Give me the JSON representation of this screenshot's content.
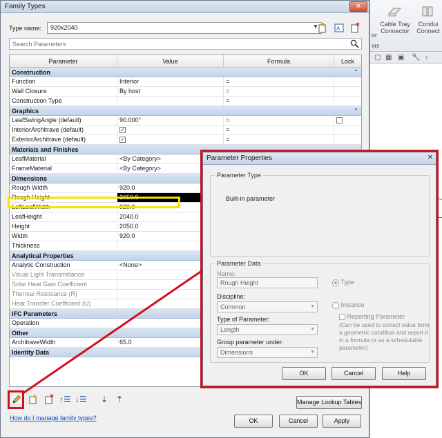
{
  "background_app": {
    "ribbon": [
      {
        "label_line1": "Cable Tray",
        "label_line2": "Connector",
        "icon": "cable-tray-connector-icon"
      },
      {
        "label_line1": "Condui",
        "label_line2": "Connect",
        "icon": "conduit-connector-icon"
      }
    ],
    "partial_label_1": "or",
    "tab_row": "ors"
  },
  "family_types": {
    "title": "Family Types",
    "close_label": "✕",
    "type_name_label": "Type name:",
    "type_name_value": "920x2040",
    "search_placeholder": "Search Parameters",
    "columns": [
      "Parameter",
      "Value",
      "Formula",
      "Lock"
    ],
    "groups": [
      {
        "name": "Construction",
        "rows": [
          {
            "param": "Function",
            "value": "Interior",
            "formula": "="
          },
          {
            "param": "Wall Closure",
            "value": "By host",
            "formula": "="
          },
          {
            "param": "Construction Type",
            "value": "",
            "formula": "="
          }
        ]
      },
      {
        "name": "Graphics",
        "rows": [
          {
            "param": "LeafSwingAngle (default)",
            "value": "90.000°",
            "formula": "=",
            "lock": true
          },
          {
            "param": "InteriorArchitrave (default)",
            "value": "checked",
            "formula": "="
          },
          {
            "param": "ExteriorArchitrave (default)",
            "value": "checked",
            "formula": "="
          }
        ]
      },
      {
        "name": "Materials and Finishes",
        "rows": [
          {
            "param": "LeafMaterial",
            "value": "<By Category>",
            "formula": ""
          },
          {
            "param": "FrameMaterial",
            "value": "<By Category>",
            "formula": ""
          }
        ]
      },
      {
        "name": "Dimensions",
        "rows": [
          {
            "param": "Rough Width",
            "value": "920.0",
            "formula": ""
          },
          {
            "param": "Rough Height",
            "value": "2050.0",
            "formula": ""
          },
          {
            "param": "LeftLeafWidth",
            "value": "920.0",
            "formula": ""
          },
          {
            "param": "LeafHeight",
            "value": "2040.0",
            "formula": ""
          },
          {
            "param": "Height",
            "value": "2050.0",
            "formula": ""
          },
          {
            "param": "Width",
            "value": "920.0",
            "formula": ""
          },
          {
            "param": "Thickness",
            "value": "",
            "formula": ""
          }
        ]
      },
      {
        "name": "Analytical Properties",
        "rows": [
          {
            "param": "Analytic Construction",
            "value": "<None>",
            "formula": ""
          },
          {
            "param": "Visual Light Transmittance",
            "value": "",
            "formula": ""
          },
          {
            "param": "Solar Heat Gain Coefficient",
            "value": "",
            "formula": ""
          },
          {
            "param": "Thermal Resistance (R)",
            "value": "",
            "formula": ""
          },
          {
            "param": "Heat Transfer Coefficient (U)",
            "value": "",
            "formula": ""
          }
        ]
      },
      {
        "name": "IFC Parameters",
        "rows": [
          {
            "param": "Operation",
            "value": "",
            "formula": ""
          }
        ]
      },
      {
        "name": "Other",
        "rows": [
          {
            "param": "ArchitraveWidth",
            "value": "65.0",
            "formula": ""
          }
        ]
      },
      {
        "name": "Identity Data",
        "rows": []
      }
    ],
    "collapse_glyph": "⌃",
    "buttons": {
      "manage_lookup": "Manage Lookup Tables",
      "ok": "OK",
      "cancel": "Cancel",
      "apply": "Apply"
    },
    "help_link": "How do I manage family types?"
  },
  "parameter_properties": {
    "title": "Parameter Properties",
    "close_label": "✕",
    "parameter_type_legend": "Parameter Type",
    "builtin_label": "Built-in parameter",
    "parameter_data_legend": "Parameter Data",
    "name_label": "Name:",
    "name_value": "Rough Height",
    "type_radio": "Type",
    "discipline_label": "Discipline:",
    "discipline_value": "Common",
    "instance_radio": "Instance",
    "reporting_label": "Reporting Parameter",
    "type_of_param_label": "Type of Parameter:",
    "type_of_param_value": "Length",
    "group_label": "Group parameter under:",
    "group_value": "Dimensions",
    "note": "(Can be used to extract value from a geometric condition and report it in a formula or as a schedulable parameter)",
    "buttons": {
      "ok": "OK",
      "cancel": "Cancel",
      "help": "Help"
    }
  },
  "colors": {
    "annotation_red": "#d20f1e",
    "annotation_yellow": "#f5e400",
    "group_header_blue": "#c3d5ea"
  }
}
